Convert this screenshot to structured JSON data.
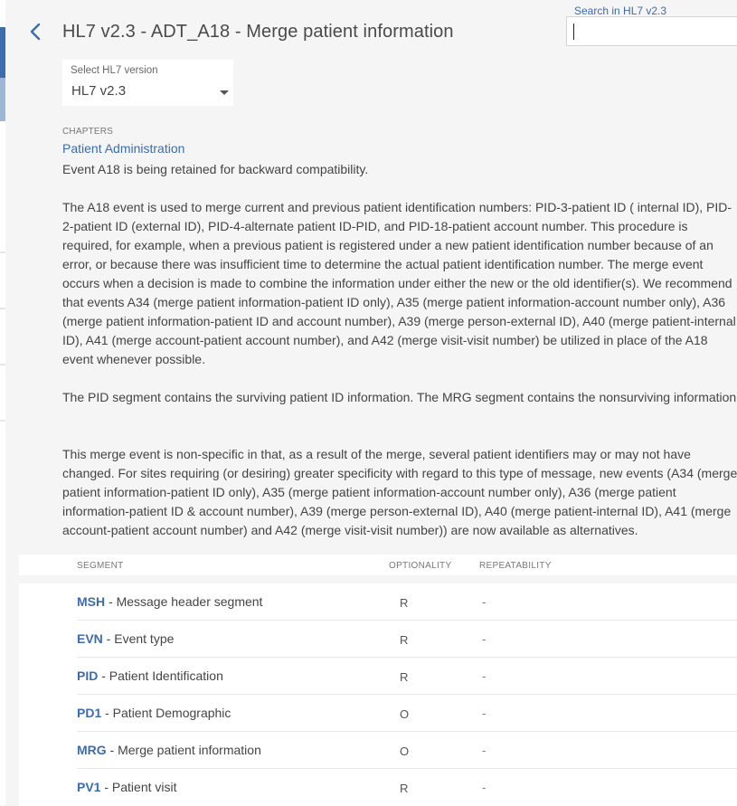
{
  "header": {
    "title": "HL7 v2.3 - ADT_A18 - Merge patient information",
    "back_icon": "chevron-left-icon"
  },
  "search": {
    "label": "Search in HL7 v2.3",
    "value": "",
    "placeholder": ""
  },
  "version_select": {
    "label": "Select HL7 version",
    "value": "HL7 v2.3"
  },
  "chapters": {
    "label": "CHAPTERS",
    "link": "Patient Administration"
  },
  "description": {
    "retained": "Event A18 is being retained for backward compatibility.",
    "paragraphs": [
      "The A18 event is used to merge current and previous patient identification numbers: PID-3-patient ID ( internal ID), PID-2-patient ID (external ID), PID-4-alternate patient ID-PID, and PID-18-patient account number. This procedure is required, for example, when a previous patient is registered under a new patient identification number because of an error, or because there was insufficient time to determine the actual patient identification number. The merge event occurs when a decision is made to combine the information under either the new or the old identifier(s). We recommend that events A34 (merge patient information-patient ID only), A35 (merge patient information-account number only), A36 (merge patient information-patient ID and account number), A39 (merge person-external ID), A40 (merge patient-internal ID), A41 (merge account-patient account number), and A42 (merge visit-visit number) be utilized in place of the A18 event whenever possible.",
      "The PID segment contains the surviving patient ID information. The MRG segment contains the nonsurviving information.",
      "This merge event is non-specific in that, as a result of the merge, several patient identifiers may or may not have changed. For sites requiring (or desiring) greater specificity with regard to this type of message, new events (A34 (merge patient information-patient ID only), A35 (merge patient information-account number only), A36 (merge patient information-patient ID & account number), A39 (merge person-external ID), A40 (merge patient-internal ID), A41 (merge account-patient account number) and A42 (merge visit-visit number)) are now available as alternatives."
    ]
  },
  "table": {
    "columns": [
      "SEGMENT",
      "OPTIONALITY",
      "REPEATABILITY"
    ],
    "rows": [
      {
        "code": "MSH",
        "desc": " - Message header segment",
        "optionality": "R",
        "repeatability": "-"
      },
      {
        "code": "EVN",
        "desc": " - Event type",
        "optionality": "R",
        "repeatability": "-"
      },
      {
        "code": "PID",
        "desc": " - Patient Identification",
        "optionality": "R",
        "repeatability": "-"
      },
      {
        "code": "PD1",
        "desc": " - Patient Demographic",
        "optionality": "O",
        "repeatability": "-"
      },
      {
        "code": "MRG",
        "desc": " - Merge patient information",
        "optionality": "O",
        "repeatability": "-"
      },
      {
        "code": "PV1",
        "desc": " - Patient visit",
        "optionality": "R",
        "repeatability": "-"
      }
    ]
  },
  "colors": {
    "accent": "#3c6cad",
    "background": "#f5f5f5"
  }
}
